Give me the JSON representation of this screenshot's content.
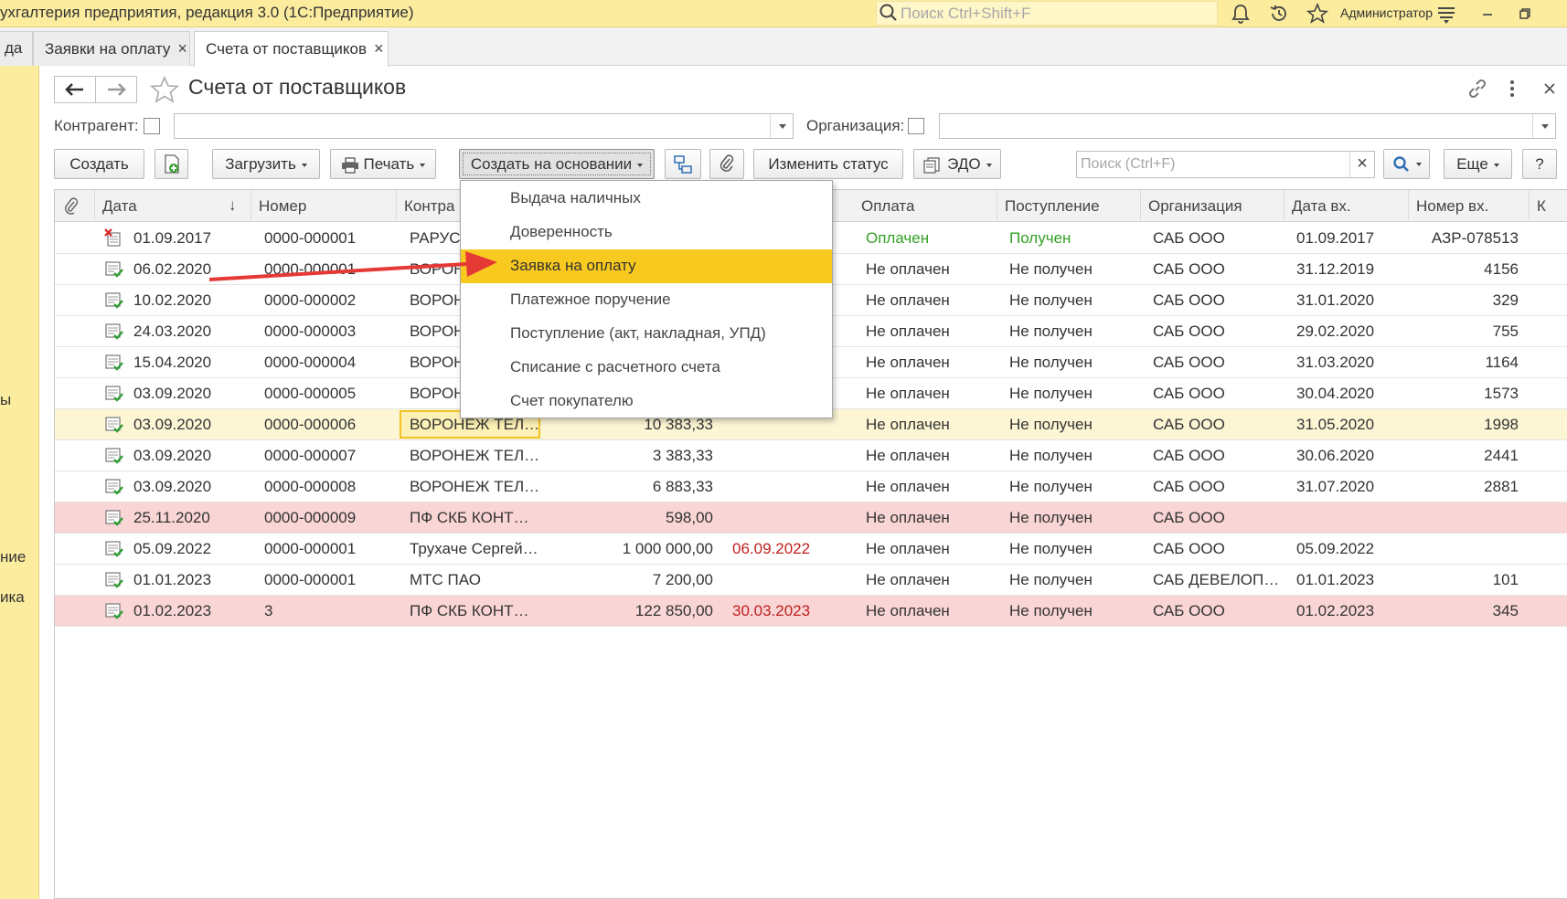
{
  "app": {
    "title": "ухгалтерия предприятия, редакция 3.0  (1С:Предприятие)",
    "search_placeholder": "Поиск Ctrl+Shift+F",
    "user": "Администратор"
  },
  "tabs": [
    {
      "label": "да"
    },
    {
      "label": "Заявки на оплату"
    },
    {
      "label": "Счета от поставщиков"
    }
  ],
  "sidebar": {
    "items": [
      {
        "label": "ы"
      },
      {
        "label": "ние"
      },
      {
        "label": "ика"
      }
    ]
  },
  "form": {
    "title": "Счета от поставщиков"
  },
  "filters": {
    "counterparty_label": "Контрагент:",
    "organization_label": "Организация:"
  },
  "toolbar": {
    "create": "Создать",
    "load": "Загрузить",
    "print": "Печать",
    "create_based_on": "Создать на основании",
    "change_status": "Изменить статус",
    "edo": "ЭДО",
    "search_placeholder": "Поиск (Ctrl+F)",
    "more": "Еще",
    "help": "?"
  },
  "grid": {
    "columns": [
      "Дата",
      "Номер",
      "Контра",
      "Оплата",
      "Поступление",
      "Организация",
      "Дата вх.",
      "Номер вх.",
      "К"
    ],
    "rows": [
      {
        "date": "01.09.2017",
        "number": "0000-000001",
        "counterparty": "РАРУС",
        "amount": "",
        "due": "",
        "payment": "Оплачен",
        "receipt": "Получен",
        "org": "САБ ООО",
        "in_date": "01.09.2017",
        "in_number": "АЗР-078513",
        "icon": "deleted-doc-icon",
        "style": ""
      },
      {
        "date": "06.02.2020",
        "number": "0000-000001",
        "counterparty": "ВОРОН",
        "amount": "",
        "due": "",
        "payment": "Не оплачен",
        "receipt": "Не получен",
        "org": "САБ ООО",
        "in_date": "31.12.2019",
        "in_number": "4156",
        "icon": "posted-doc-icon",
        "style": ""
      },
      {
        "date": "10.02.2020",
        "number": "0000-000002",
        "counterparty": "ВОРОН",
        "amount": "",
        "due": "",
        "payment": "Не оплачен",
        "receipt": "Не получен",
        "org": "САБ ООО",
        "in_date": "31.01.2020",
        "in_number": "329",
        "icon": "posted-doc-icon",
        "style": ""
      },
      {
        "date": "24.03.2020",
        "number": "0000-000003",
        "counterparty": "ВОРОН",
        "amount": "",
        "due": "",
        "payment": "Не оплачен",
        "receipt": "Не получен",
        "org": "САБ ООО",
        "in_date": "29.02.2020",
        "in_number": "755",
        "icon": "posted-doc-icon",
        "style": ""
      },
      {
        "date": "15.04.2020",
        "number": "0000-000004",
        "counterparty": "ВОРОН",
        "amount": "",
        "due": "",
        "payment": "Не оплачен",
        "receipt": "Не получен",
        "org": "САБ ООО",
        "in_date": "31.03.2020",
        "in_number": "1164",
        "icon": "posted-doc-icon",
        "style": ""
      },
      {
        "date": "03.09.2020",
        "number": "0000-000005",
        "counterparty": "ВОРОН",
        "amount": "",
        "due": "",
        "payment": "Не оплачен",
        "receipt": "Не получен",
        "org": "САБ ООО",
        "in_date": "30.04.2020",
        "in_number": "1573",
        "icon": "posted-doc-icon",
        "style": ""
      },
      {
        "date": "03.09.2020",
        "number": "0000-000006",
        "counterparty": "ВОРОНЕЖ ТЕЛ…",
        "amount": "10 383,33",
        "due": "",
        "payment": "Не оплачен",
        "receipt": "Не получен",
        "org": "САБ ООО",
        "in_date": "31.05.2020",
        "in_number": "1998",
        "icon": "posted-doc-icon",
        "style": "hl"
      },
      {
        "date": "03.09.2020",
        "number": "0000-000007",
        "counterparty": "ВОРОНЕЖ ТЕЛ…",
        "amount": "3 383,33",
        "due": "",
        "payment": "Не оплачен",
        "receipt": "Не получен",
        "org": "САБ ООО",
        "in_date": "30.06.2020",
        "in_number": "2441",
        "icon": "posted-doc-icon",
        "style": ""
      },
      {
        "date": "03.09.2020",
        "number": "0000-000008",
        "counterparty": "ВОРОНЕЖ ТЕЛ…",
        "amount": "6 883,33",
        "due": "",
        "payment": "Не оплачен",
        "receipt": "Не получен",
        "org": "САБ ООО",
        "in_date": "31.07.2020",
        "in_number": "2881",
        "icon": "posted-doc-icon",
        "style": ""
      },
      {
        "date": "25.11.2020",
        "number": "0000-000009",
        "counterparty": "ПФ СКБ КОНТ…",
        "amount": "598,00",
        "due": "",
        "payment": "Не оплачен",
        "receipt": "Не получен",
        "org": "САБ ООО",
        "in_date": "",
        "in_number": "",
        "icon": "posted-doc-icon",
        "style": "pink"
      },
      {
        "date": "05.09.2022",
        "number": "0000-000001",
        "counterparty": "Трухаче Сергей…",
        "amount": "1 000 000,00",
        "due": "06.09.2022",
        "payment": "Не оплачен",
        "receipt": "Не получен",
        "org": "САБ ООО",
        "in_date": "05.09.2022",
        "in_number": "",
        "icon": "posted-doc-icon",
        "style": ""
      },
      {
        "date": "01.01.2023",
        "number": "0000-000001",
        "counterparty": "МТС ПАО",
        "amount": "7 200,00",
        "due": "",
        "payment": "Не оплачен",
        "receipt": "Не получен",
        "org": "САБ ДЕВЕЛОП…",
        "in_date": "01.01.2023",
        "in_number": "101",
        "icon": "posted-doc-icon",
        "style": ""
      },
      {
        "date": "01.02.2023",
        "number": "3",
        "counterparty": "ПФ СКБ КОНТ…",
        "amount": "122 850,00",
        "due": "30.03.2023",
        "payment": "Не оплачен",
        "receipt": "Не получен",
        "org": "САБ ООО",
        "in_date": "01.02.2023",
        "in_number": "345",
        "icon": "posted-doc-icon",
        "style": "pink"
      }
    ]
  },
  "dropdown": {
    "items": [
      "Выдача наличных",
      "Доверенность",
      "Заявка на оплату",
      "Платежное поручение",
      "Поступление (акт, накладная, УПД)",
      "Списание с расчетного счета",
      "Счет покупателю"
    ],
    "active_index": 2
  },
  "colors": {
    "accent_yellow": "#fbec9e",
    "menu_active": "#f8c91e",
    "paid_green": "#34a026",
    "due_red": "#c02020",
    "row_pink": "#f9d5d5",
    "annotation_arrow": "#e53935"
  }
}
